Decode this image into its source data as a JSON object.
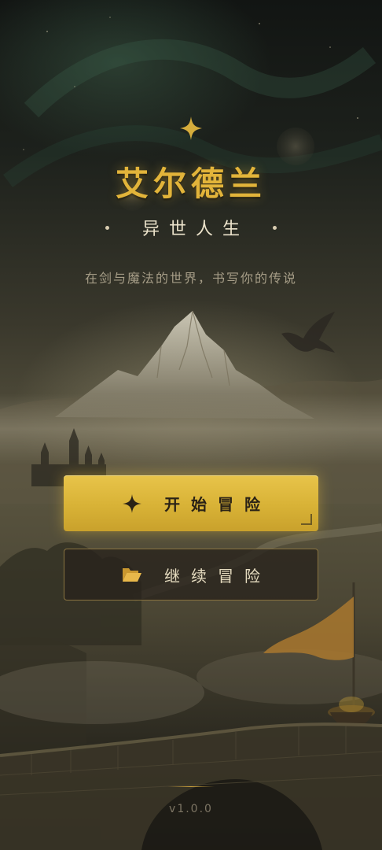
{
  "game": {
    "title": "艾尔德兰",
    "subtitle": "异世人生",
    "tagline": "在剑与魔法的世界，书写你的传说"
  },
  "menu": {
    "start_label": "开始冒险",
    "start_icon": "four-point-star-icon",
    "continue_label": "继续冒险",
    "continue_icon": "open-folder-icon"
  },
  "footer": {
    "version": "v1.0.0"
  },
  "colors": {
    "accent_gold": "#e2b43a",
    "button_gold": "#d8b236",
    "text_light": "#ece3cb",
    "text_muted": "#a69d87"
  }
}
